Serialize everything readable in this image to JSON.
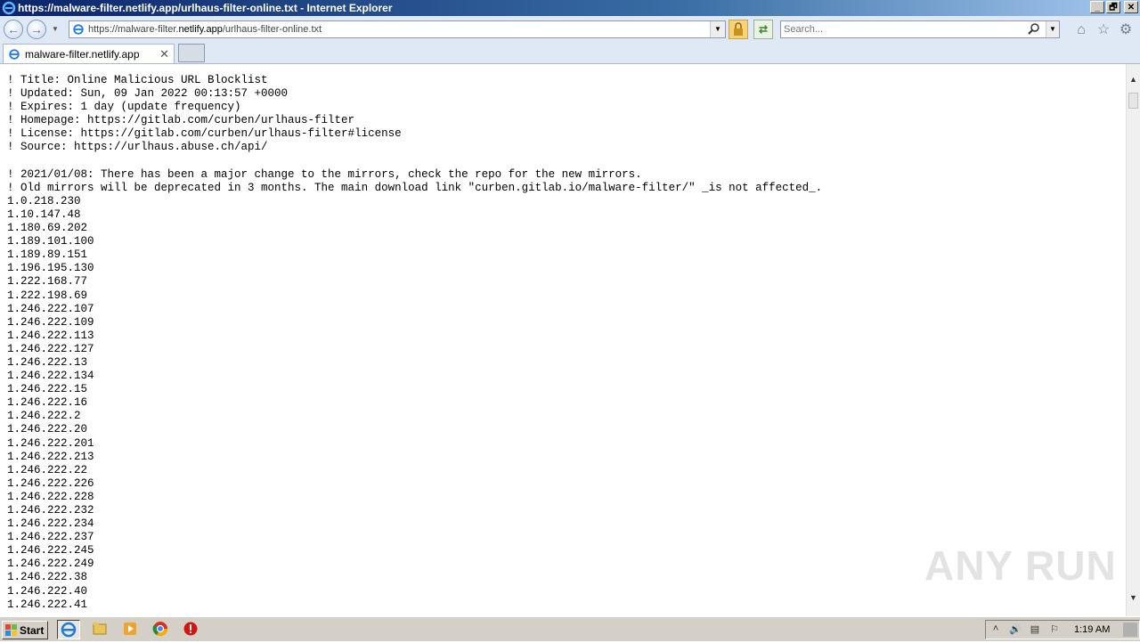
{
  "window": {
    "title": "https://malware-filter.netlify.app/urlhaus-filter-online.txt - Internet Explorer",
    "buttons": [
      "_",
      "🗗",
      "✕"
    ]
  },
  "navbar": {
    "address_prefix": "https://malware-filter.",
    "address_domain": "netlify.app",
    "address_path": "/urlhaus-filter-online.txt",
    "search_placeholder": "Search...",
    "icons": [
      "back-arrow-icon",
      "forward-arrow-icon",
      "lock-icon",
      "compatibility-icon",
      "home-icon",
      "star-icon",
      "gear-icon"
    ]
  },
  "tab": {
    "label": "malware-filter.netlify.app",
    "close": "✕"
  },
  "content": {
    "lines": [
      "! Title: Online Malicious URL Blocklist",
      "! Updated: Sun, 09 Jan 2022 00:13:57 +0000",
      "! Expires: 1 day (update frequency)",
      "! Homepage: https://gitlab.com/curben/urlhaus-filter",
      "! License: https://gitlab.com/curben/urlhaus-filter#license",
      "! Source: https://urlhaus.abuse.ch/api/",
      "",
      "! 2021/01/08: There has been a major change to the mirrors, check the repo for the new mirrors.",
      "! Old mirrors will be deprecated in 3 months. The main download link \"curben.gitlab.io/malware-filter/\" _is not affected_.",
      "1.0.218.230",
      "1.10.147.48",
      "1.180.69.202",
      "1.189.101.100",
      "1.189.89.151",
      "1.196.195.130",
      "1.222.168.77",
      "1.222.198.69",
      "1.246.222.107",
      "1.246.222.109",
      "1.246.222.113",
      "1.246.222.127",
      "1.246.222.13",
      "1.246.222.134",
      "1.246.222.15",
      "1.246.222.16",
      "1.246.222.2",
      "1.246.222.20",
      "1.246.222.201",
      "1.246.222.213",
      "1.246.222.22",
      "1.246.222.226",
      "1.246.222.228",
      "1.246.222.232",
      "1.246.222.234",
      "1.246.222.237",
      "1.246.222.245",
      "1.246.222.249",
      "1.246.222.38",
      "1.246.222.40",
      "1.246.222.41"
    ]
  },
  "watermark": "ANY RUN",
  "taskbar": {
    "start_label": "Start",
    "clock": "1:19 AM",
    "apps": [
      "ie-icon",
      "folder-icon",
      "media-player-icon",
      "chrome-icon",
      "antivirus-icon"
    ]
  }
}
